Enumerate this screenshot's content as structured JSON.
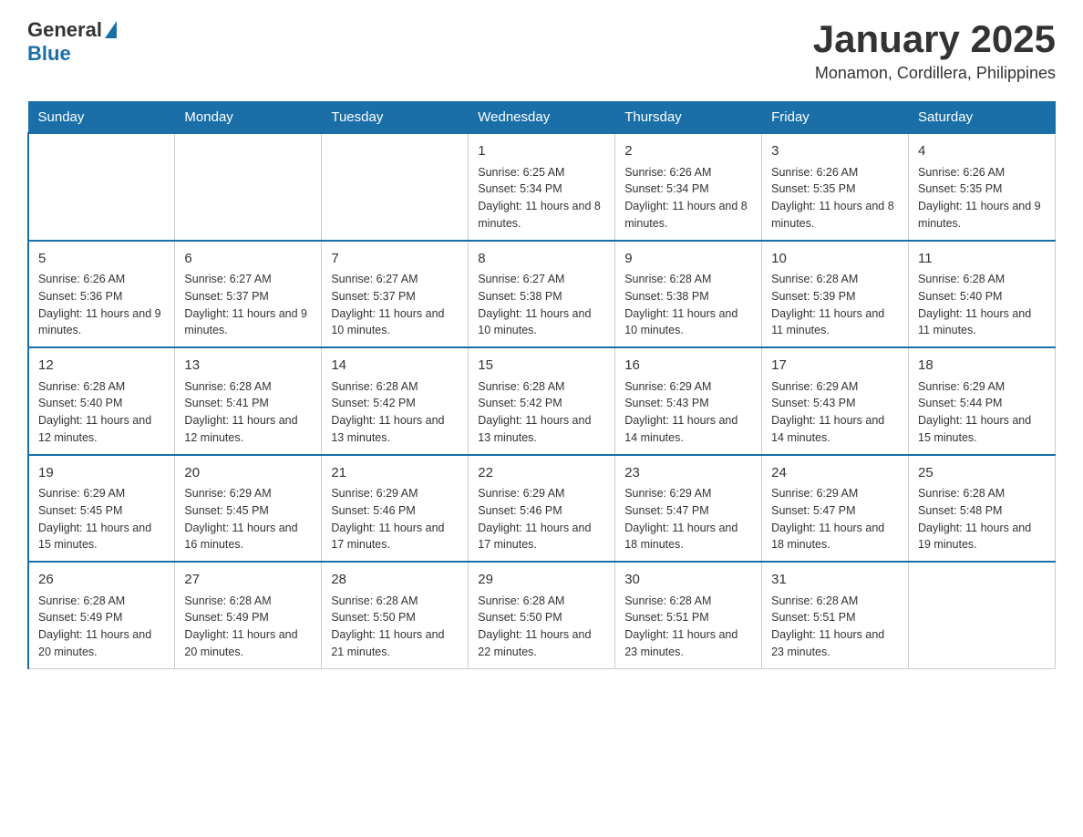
{
  "header": {
    "logo": {
      "text_general": "General",
      "text_blue": "Blue"
    },
    "title": "January 2025",
    "subtitle": "Monamon, Cordillera, Philippines"
  },
  "days_of_week": [
    "Sunday",
    "Monday",
    "Tuesday",
    "Wednesday",
    "Thursday",
    "Friday",
    "Saturday"
  ],
  "weeks": [
    [
      {
        "day": "",
        "info": ""
      },
      {
        "day": "",
        "info": ""
      },
      {
        "day": "",
        "info": ""
      },
      {
        "day": "1",
        "info": "Sunrise: 6:25 AM\nSunset: 5:34 PM\nDaylight: 11 hours and 8 minutes."
      },
      {
        "day": "2",
        "info": "Sunrise: 6:26 AM\nSunset: 5:34 PM\nDaylight: 11 hours and 8 minutes."
      },
      {
        "day": "3",
        "info": "Sunrise: 6:26 AM\nSunset: 5:35 PM\nDaylight: 11 hours and 8 minutes."
      },
      {
        "day": "4",
        "info": "Sunrise: 6:26 AM\nSunset: 5:35 PM\nDaylight: 11 hours and 9 minutes."
      }
    ],
    [
      {
        "day": "5",
        "info": "Sunrise: 6:26 AM\nSunset: 5:36 PM\nDaylight: 11 hours and 9 minutes."
      },
      {
        "day": "6",
        "info": "Sunrise: 6:27 AM\nSunset: 5:37 PM\nDaylight: 11 hours and 9 minutes."
      },
      {
        "day": "7",
        "info": "Sunrise: 6:27 AM\nSunset: 5:37 PM\nDaylight: 11 hours and 10 minutes."
      },
      {
        "day": "8",
        "info": "Sunrise: 6:27 AM\nSunset: 5:38 PM\nDaylight: 11 hours and 10 minutes."
      },
      {
        "day": "9",
        "info": "Sunrise: 6:28 AM\nSunset: 5:38 PM\nDaylight: 11 hours and 10 minutes."
      },
      {
        "day": "10",
        "info": "Sunrise: 6:28 AM\nSunset: 5:39 PM\nDaylight: 11 hours and 11 minutes."
      },
      {
        "day": "11",
        "info": "Sunrise: 6:28 AM\nSunset: 5:40 PM\nDaylight: 11 hours and 11 minutes."
      }
    ],
    [
      {
        "day": "12",
        "info": "Sunrise: 6:28 AM\nSunset: 5:40 PM\nDaylight: 11 hours and 12 minutes."
      },
      {
        "day": "13",
        "info": "Sunrise: 6:28 AM\nSunset: 5:41 PM\nDaylight: 11 hours and 12 minutes."
      },
      {
        "day": "14",
        "info": "Sunrise: 6:28 AM\nSunset: 5:42 PM\nDaylight: 11 hours and 13 minutes."
      },
      {
        "day": "15",
        "info": "Sunrise: 6:28 AM\nSunset: 5:42 PM\nDaylight: 11 hours and 13 minutes."
      },
      {
        "day": "16",
        "info": "Sunrise: 6:29 AM\nSunset: 5:43 PM\nDaylight: 11 hours and 14 minutes."
      },
      {
        "day": "17",
        "info": "Sunrise: 6:29 AM\nSunset: 5:43 PM\nDaylight: 11 hours and 14 minutes."
      },
      {
        "day": "18",
        "info": "Sunrise: 6:29 AM\nSunset: 5:44 PM\nDaylight: 11 hours and 15 minutes."
      }
    ],
    [
      {
        "day": "19",
        "info": "Sunrise: 6:29 AM\nSunset: 5:45 PM\nDaylight: 11 hours and 15 minutes."
      },
      {
        "day": "20",
        "info": "Sunrise: 6:29 AM\nSunset: 5:45 PM\nDaylight: 11 hours and 16 minutes."
      },
      {
        "day": "21",
        "info": "Sunrise: 6:29 AM\nSunset: 5:46 PM\nDaylight: 11 hours and 17 minutes."
      },
      {
        "day": "22",
        "info": "Sunrise: 6:29 AM\nSunset: 5:46 PM\nDaylight: 11 hours and 17 minutes."
      },
      {
        "day": "23",
        "info": "Sunrise: 6:29 AM\nSunset: 5:47 PM\nDaylight: 11 hours and 18 minutes."
      },
      {
        "day": "24",
        "info": "Sunrise: 6:29 AM\nSunset: 5:47 PM\nDaylight: 11 hours and 18 minutes."
      },
      {
        "day": "25",
        "info": "Sunrise: 6:28 AM\nSunset: 5:48 PM\nDaylight: 11 hours and 19 minutes."
      }
    ],
    [
      {
        "day": "26",
        "info": "Sunrise: 6:28 AM\nSunset: 5:49 PM\nDaylight: 11 hours and 20 minutes."
      },
      {
        "day": "27",
        "info": "Sunrise: 6:28 AM\nSunset: 5:49 PM\nDaylight: 11 hours and 20 minutes."
      },
      {
        "day": "28",
        "info": "Sunrise: 6:28 AM\nSunset: 5:50 PM\nDaylight: 11 hours and 21 minutes."
      },
      {
        "day": "29",
        "info": "Sunrise: 6:28 AM\nSunset: 5:50 PM\nDaylight: 11 hours and 22 minutes."
      },
      {
        "day": "30",
        "info": "Sunrise: 6:28 AM\nSunset: 5:51 PM\nDaylight: 11 hours and 23 minutes."
      },
      {
        "day": "31",
        "info": "Sunrise: 6:28 AM\nSunset: 5:51 PM\nDaylight: 11 hours and 23 minutes."
      },
      {
        "day": "",
        "info": ""
      }
    ]
  ]
}
